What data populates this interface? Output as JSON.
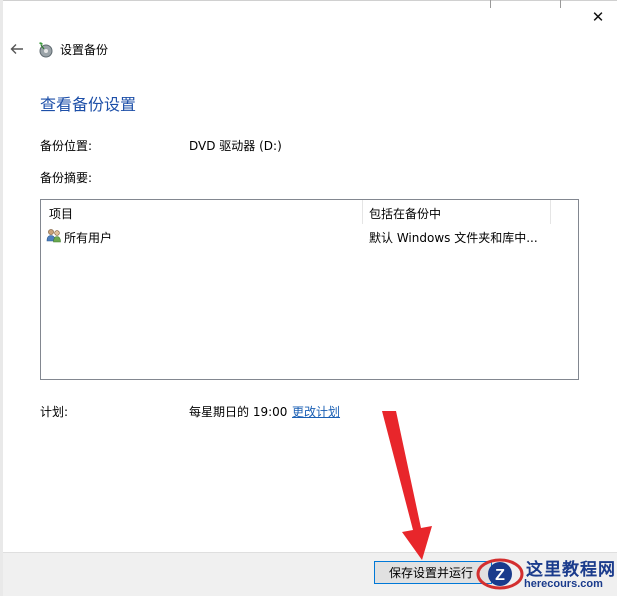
{
  "window": {
    "title": "设置备份",
    "close_glyph": "✕",
    "back_glyph": "←"
  },
  "page": {
    "heading": "查看备份设置"
  },
  "settings": {
    "location_label": "备份位置:",
    "location_value": "DVD 驱动器 (D:)",
    "summary_label": "备份摘要:"
  },
  "table": {
    "columns": [
      "项目",
      "包括在备份中"
    ],
    "rows": [
      {
        "icon": "users-icon",
        "item": "所有用户",
        "included": "默认 Windows 文件夹和库中..."
      }
    ]
  },
  "schedule": {
    "label": "计划:",
    "value": "每星期日的 19:00",
    "change_link": "更改计划"
  },
  "footer": {
    "save_run_button": "保存设置并运行"
  },
  "watermark": {
    "line1": "这里教程网",
    "line2": "herecours.com"
  },
  "colors": {
    "heading": "#1d4fa8",
    "link": "#1a5fb4",
    "button_border": "#0078d7",
    "annotation_arrow": "#e8262b",
    "watermark": "#1a3b8c"
  }
}
